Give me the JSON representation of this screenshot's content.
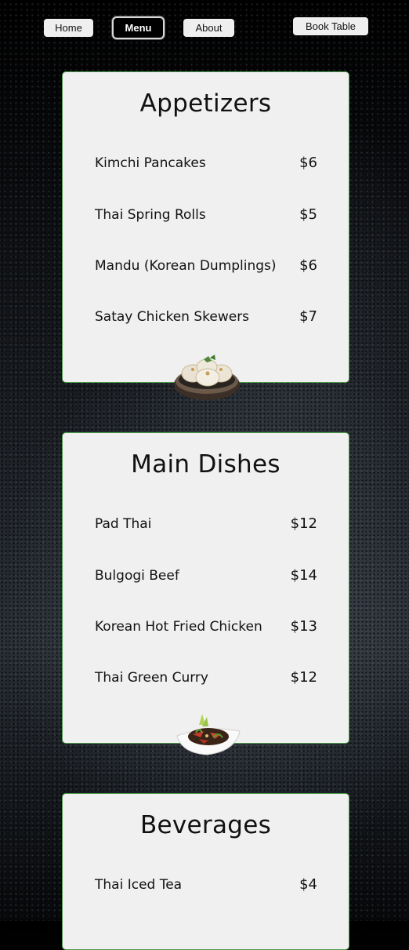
{
  "nav": {
    "home_label": "Home",
    "menu_label": "Menu",
    "about_label": "About",
    "book_label": "Book Table"
  },
  "sections": [
    {
      "title": "Appetizers",
      "image_icon": "dumplings-plate-image",
      "items": [
        {
          "name": "Kimchi Pancakes",
          "price": "$6"
        },
        {
          "name": "Thai Spring Rolls",
          "price": "$5"
        },
        {
          "name": "Mandu (Korean Dumplings)",
          "price": "$6"
        },
        {
          "name": "Satay Chicken Skewers",
          "price": "$7"
        }
      ]
    },
    {
      "title": "Main Dishes",
      "image_icon": "stir-fry-bowl-image",
      "items": [
        {
          "name": "Pad Thai",
          "price": "$12"
        },
        {
          "name": "Bulgogi Beef",
          "price": "$14"
        },
        {
          "name": "Korean Hot Fried Chicken",
          "price": "$13"
        },
        {
          "name": "Thai Green Curry",
          "price": "$12"
        }
      ]
    },
    {
      "title": "Beverages",
      "items": [
        {
          "name": "Thai Iced Tea",
          "price": "$4"
        }
      ]
    }
  ],
  "colors": {
    "card_background": "#f0f0f0",
    "card_border": "#4a9a4a",
    "nav_button": "#efefef",
    "nav_active": "#000000"
  }
}
